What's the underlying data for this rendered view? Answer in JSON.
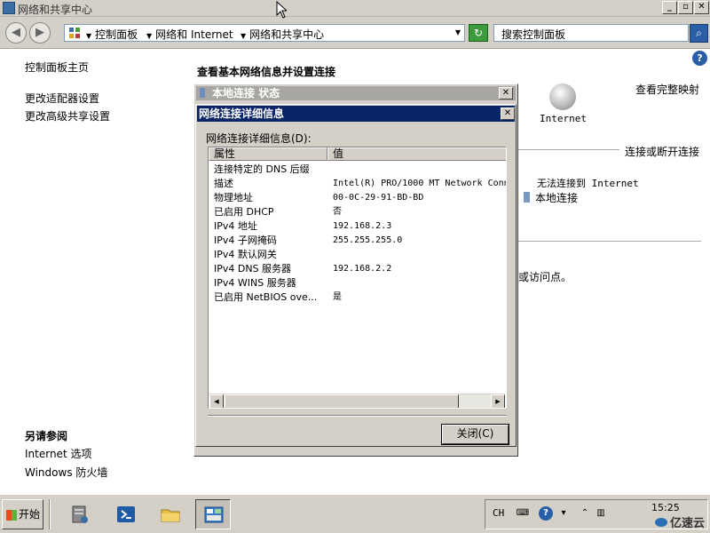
{
  "window": {
    "title": "网络和共享中心",
    "min_label": "_",
    "max_label": "▫",
    "close_label": "✕"
  },
  "addressbar": {
    "breadcrumbs": [
      "控制面板",
      "网络和 Internet",
      "网络和共享中心"
    ],
    "search_placeholder": "搜索控制面板",
    "back_label": "◀",
    "forward_label": "▶",
    "refresh_label": "↻",
    "search_btn_label": "⌕"
  },
  "left_pane": {
    "home": "控制面板主页",
    "links": [
      "更改适配器设置",
      "更改高级共享设置"
    ],
    "see_also_title": "另请参阅",
    "see_also": [
      "Internet 选项",
      "Windows 防火墙"
    ]
  },
  "main": {
    "title": "查看基本网络信息并设置连接",
    "view_full_map": "查看完整映射",
    "internet_label": "Internet",
    "connect_disconnect": "连接或断开连接",
    "cannot_connect": "无法连接到 Internet",
    "local_connection": "本地连接",
    "access_point_text": "或访问点。",
    "help_label": "?"
  },
  "status_dialog": {
    "title": "本地连接 状态",
    "close_label": "✕"
  },
  "details_dialog": {
    "title": "网络连接详细信息",
    "close_label": "✕",
    "list_label": "网络连接详细信息(D):",
    "columns": [
      "属性",
      "值"
    ],
    "rows": [
      {
        "property": "连接特定的 DNS 后缀",
        "value": ""
      },
      {
        "property": "描述",
        "value": "Intel(R) PRO/1000 MT Network Conn"
      },
      {
        "property": "物理地址",
        "value": "00-0C-29-91-BD-BD"
      },
      {
        "property": "已启用 DHCP",
        "value": "否"
      },
      {
        "property": "IPv4 地址",
        "value": "192.168.2.3"
      },
      {
        "property": "IPv4 子网掩码",
        "value": "255.255.255.0"
      },
      {
        "property": "IPv4 默认网关",
        "value": ""
      },
      {
        "property": "IPv4 DNS 服务器",
        "value": "192.168.2.2"
      },
      {
        "property": "IPv4 WINS 服务器",
        "value": ""
      },
      {
        "property": "已启用 NetBIOS ove...",
        "value": "是"
      }
    ],
    "scroll_left": "◀",
    "scroll_right": "▶",
    "close_button": "关闭(C)"
  },
  "taskbar": {
    "start_label": "开始",
    "language": "CH",
    "time": "15:25",
    "icons": [
      "server-manager-icon",
      "powershell-icon",
      "explorer-icon",
      "network-center-icon"
    ]
  },
  "watermark": "亿速云"
}
